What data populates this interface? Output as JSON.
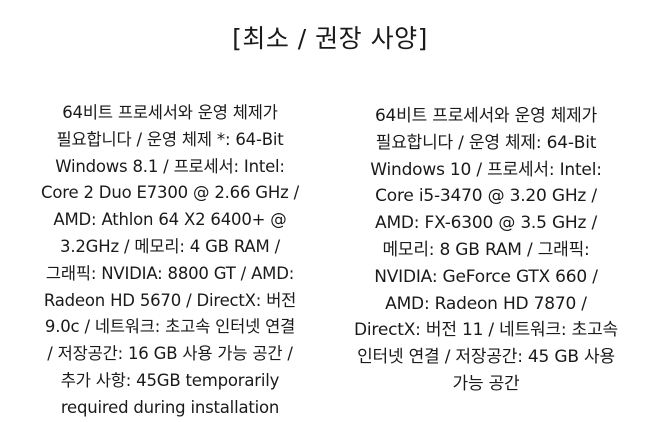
{
  "heading": "[최소 / 권장 사양]",
  "minimum": {
    "lines": [
      "64비트 프로세서와 운영 체제가",
      "필요합니다 / 운영 체제 *: 64-Bit",
      "Windows 8.1 / 프로세서: Intel:",
      "Core 2 Duo E7300 @ 2.66 GHz /",
      "AMD: Athlon 64 X2 6400+ @",
      "3.2GHz / 메모리: 4 GB RAM /",
      "그래픽: NVIDIA: 8800 GT / AMD:",
      "Radeon HD 5670 / DirectX: 버전",
      "9.0c / 네트워크: 초고속 인터넷 연결",
      "/ 저장공간: 16 GB 사용 가능 공간 /",
      "추가 사항: 45GB temporarily",
      "required during installation"
    ]
  },
  "recommended": {
    "lines": [
      "64비트 프로세서와 운영 체제가",
      "필요합니다 / 운영 체제: 64-Bit",
      "Windows 10 / 프로세서: Intel:",
      "Core i5-3470 @ 3.20 GHz /",
      "AMD: FX-6300 @ 3.5 GHz /",
      "메모리: 8 GB RAM / 그래픽:",
      "NVIDIA: GeForce GTX 660 /",
      "AMD: Radeon HD 7870 /",
      "DirectX: 버전 11 / 네트워크: 초고속",
      "인터넷 연결 / 저장공간: 45 GB 사용",
      "가능 공간"
    ]
  }
}
